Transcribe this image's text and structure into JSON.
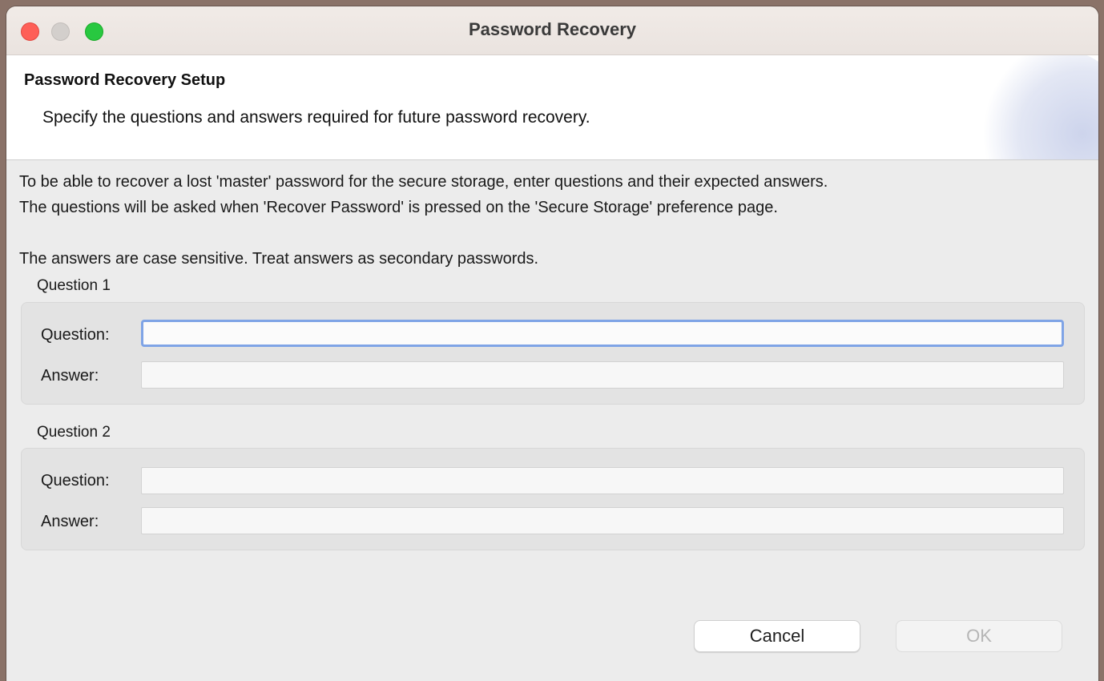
{
  "window": {
    "title": "Password Recovery"
  },
  "banner": {
    "title": "Password Recovery Setup",
    "description": "Specify the questions and answers required for future password recovery."
  },
  "info": {
    "line1": "To be able to recover a lost 'master' password for the secure storage, enter questions and their expected answers.",
    "line2": "The questions will be asked when 'Recover Password' is pressed on the 'Secure Storage' preference page.",
    "line3": "The answers are case sensitive. Treat answers as secondary passwords."
  },
  "groups": [
    {
      "label": "Question 1",
      "question_label": "Question:",
      "question_value": "",
      "answer_label": "Answer:",
      "answer_value": ""
    },
    {
      "label": "Question 2",
      "question_label": "Question:",
      "question_value": "",
      "answer_label": "Answer:",
      "answer_value": ""
    }
  ],
  "buttons": {
    "cancel": "Cancel",
    "ok": "OK"
  },
  "colors": {
    "close": "#fe5f57",
    "minimize_disabled": "#d3cfcc",
    "maximize": "#28c840",
    "focus_ring": "#7fa4e6"
  }
}
